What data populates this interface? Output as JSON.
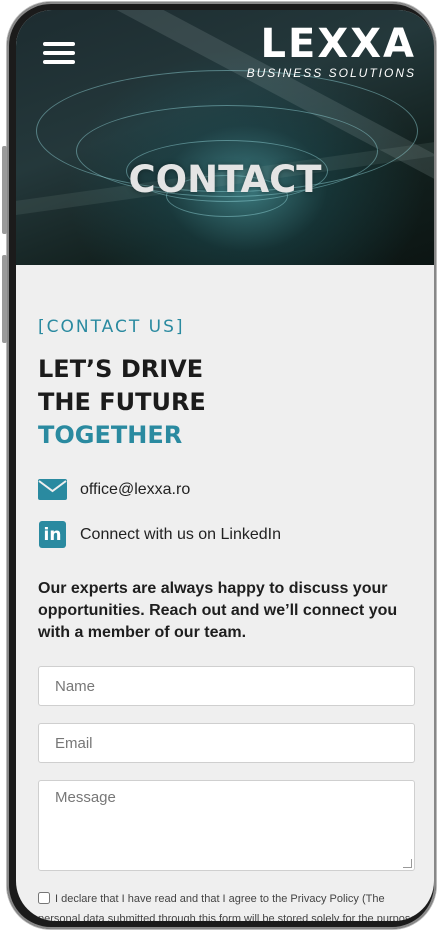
{
  "header": {
    "logo_text": "LEXXA",
    "logo_subtitle": "BUSINESS SOLUTIONS",
    "menu_icon": "hamburger-menu-icon"
  },
  "hero": {
    "title": "CONTACT"
  },
  "contact": {
    "eyebrow": "[CONTACT US]",
    "headline_line1": "LET’S DRIVE",
    "headline_line2": "THE FUTURE",
    "headline_line3": "TOGETHER",
    "email_icon": "envelope-icon",
    "email": "office@lexxa.ro",
    "linkedin_icon": "linkedin-icon",
    "linkedin_text": "Connect with us on LinkedIn",
    "intro": "Our experts are always happy to discuss your opportunities. Reach out and we’ll connect you with a member of our team."
  },
  "form": {
    "name_placeholder": "Name",
    "email_placeholder": "Email",
    "message_placeholder": "Message",
    "consent_text": "I declare that I have read and that I agree to the Privacy Policy (The personal data submitted through this form will be stored solely for the purpose"
  },
  "colors": {
    "accent": "#2a8aa0",
    "background": "#efefef",
    "text": "#1b1b1b"
  }
}
